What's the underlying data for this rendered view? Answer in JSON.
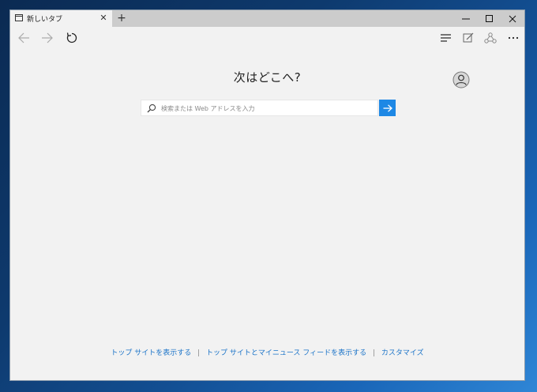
{
  "tab": {
    "title": "新しいタブ",
    "close_icon": "close-icon"
  },
  "window": {
    "new_tab_label": "+"
  },
  "nav": {
    "back_icon": "arrow-left-icon",
    "forward_icon": "arrow-right-icon",
    "refresh_icon": "refresh-icon",
    "hub_icon": "hub-icon",
    "note_icon": "web-note-icon",
    "share_icon": "share-icon",
    "more_icon": "more-icon"
  },
  "page": {
    "heading": "次はどこへ?",
    "search_placeholder": "検索または Web アドレスを入力",
    "search_value": ""
  },
  "footer": {
    "link1": "トップ サイトを表示する",
    "separator": "|",
    "link2": "トップ サイトとマイニュース フィードを表示する",
    "link3": "カスタマイズ"
  },
  "colors": {
    "accent": "#1e88e5",
    "link": "#1a73c8"
  }
}
